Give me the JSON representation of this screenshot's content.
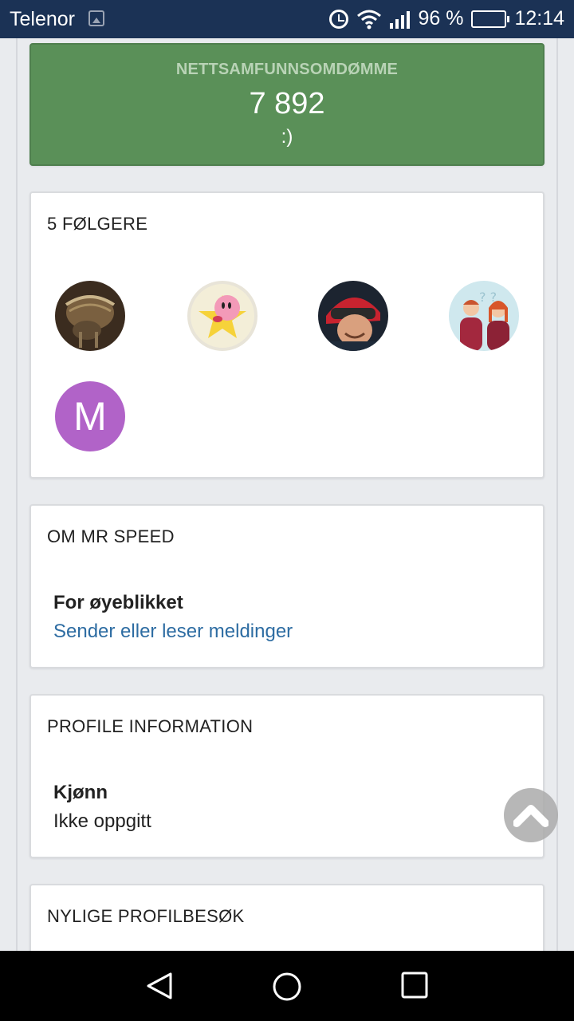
{
  "status_bar": {
    "carrier": "Telenor",
    "battery_percent": "96 %",
    "time": "12:14",
    "icons": [
      "image-notification-icon",
      "alarm-icon",
      "wifi-icon",
      "signal-icon",
      "battery-icon"
    ]
  },
  "reputation": {
    "label": "NETTSAMFUNNSOMDØMME",
    "value": "7 892",
    "smiley": ":)",
    "color": "#5a9058"
  },
  "followers": {
    "title": "5 FØLGERE",
    "avatars": [
      {
        "type": "image",
        "subject": "creature photo"
      },
      {
        "type": "image",
        "subject": "pink character on star"
      },
      {
        "type": "image",
        "subject": "person with helmet and goggles"
      },
      {
        "type": "image",
        "subject": "two cartoon people with question marks"
      },
      {
        "type": "letter",
        "letter": "M",
        "color": "#b163c8"
      }
    ]
  },
  "about": {
    "title": "OM MR SPEED",
    "label": "For øyeblikket",
    "value": "Sender eller leser meldinger"
  },
  "profile_info": {
    "title": "PROFILE INFORMATION",
    "label": "Kjønn",
    "value": "Ikke oppgitt"
  },
  "recent_visits": {
    "title": "NYLIGE PROFILBESØK"
  },
  "scroll_top_button": {
    "icon": "chevron-up-icon"
  },
  "nav_bar": {
    "icons": [
      "back-icon",
      "home-icon",
      "recents-icon"
    ]
  }
}
